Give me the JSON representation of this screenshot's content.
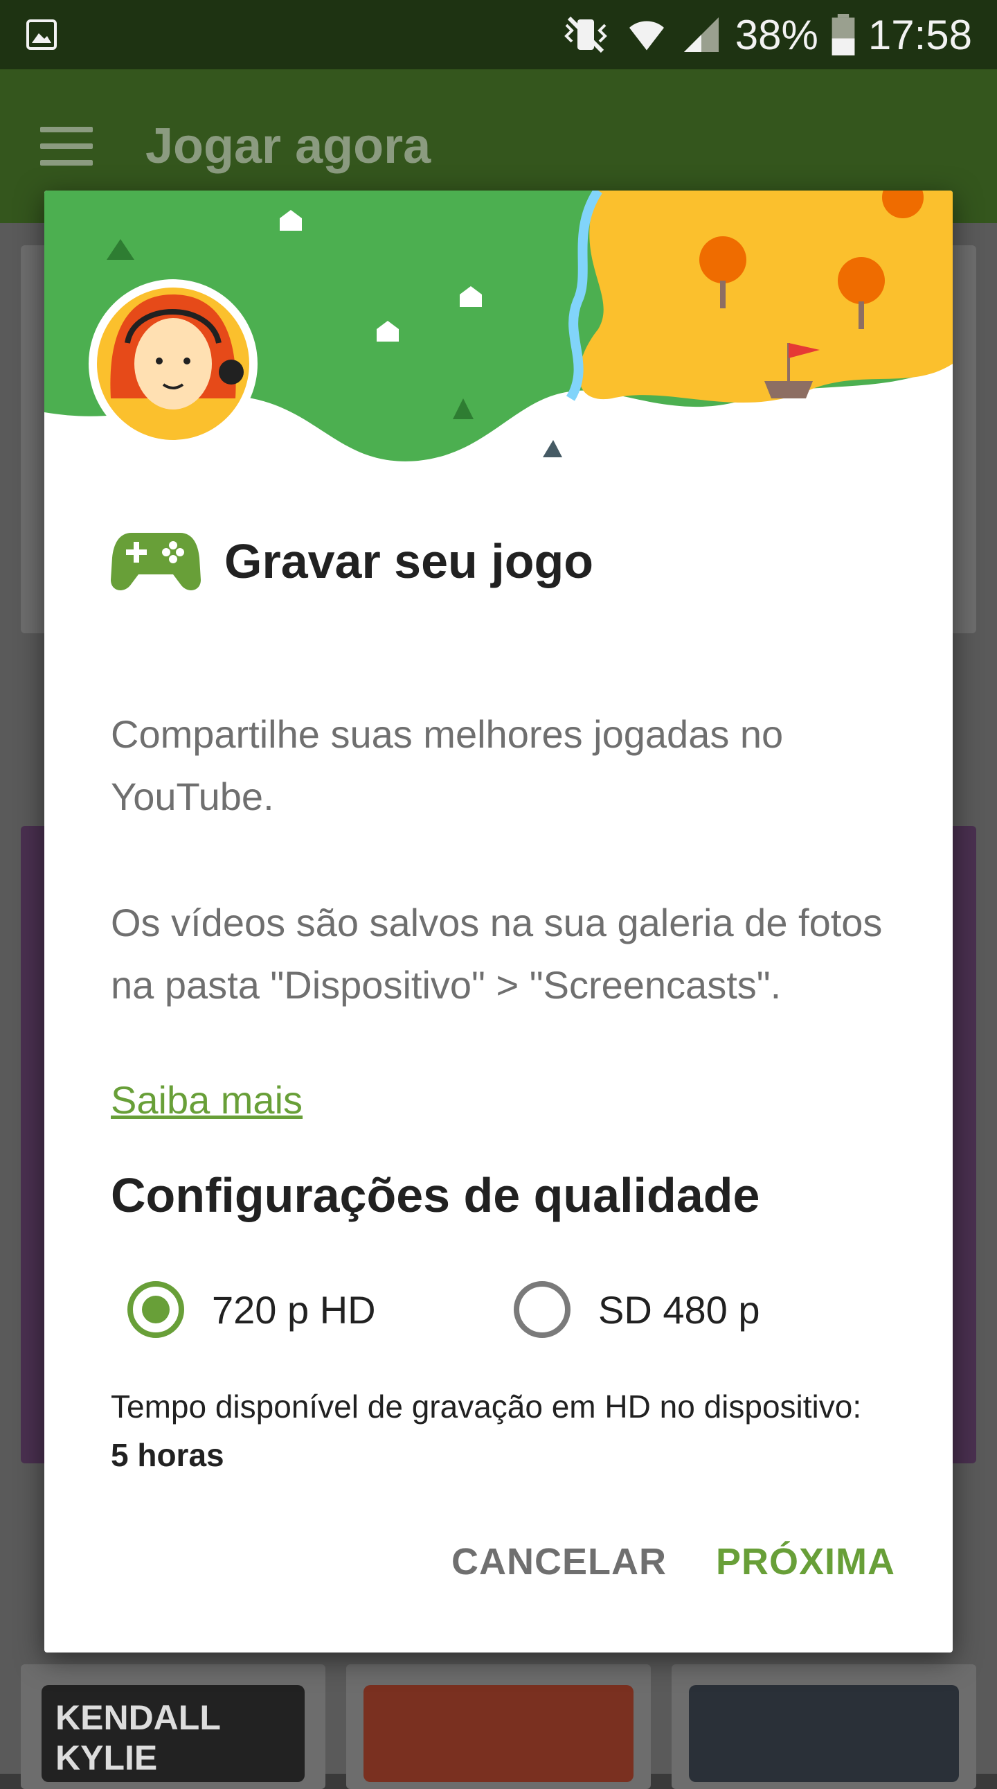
{
  "status_bar": {
    "battery": "38%",
    "time": "17:58",
    "icons": [
      "gallery-icon",
      "vibrate-icon",
      "wifi-icon",
      "signal-icon",
      "battery-icon"
    ]
  },
  "app_bar": {
    "title": "Jogar agora",
    "menu_icon": "menu-icon"
  },
  "dialog": {
    "icon": "gamepad-icon",
    "title": "Gravar seu jogo",
    "paragraph1": "Compartilhe suas melhores jogadas no YouTube.",
    "paragraph2": "Os vídeos são salvos na sua galeria de fotos na pasta \"Dispositivo\" > \"Screencasts\".",
    "link": "Saiba mais",
    "quality_title": "Configurações de qualidade",
    "options": [
      {
        "label": "720 p HD",
        "selected": true
      },
      {
        "label": "SD 480 p",
        "selected": false
      }
    ],
    "note_prefix": "Tempo disponível de gravação em HD no dispositivo: ",
    "note_value": "5 horas",
    "cancel_label": "CANCELAR",
    "next_label": "PRÓXIMA"
  },
  "background": {
    "thumbnail_text": "KENDALL KYLIE"
  },
  "colors": {
    "accent": "#689f38",
    "app_bar": "#34561d",
    "status_bar": "#1e3312"
  }
}
